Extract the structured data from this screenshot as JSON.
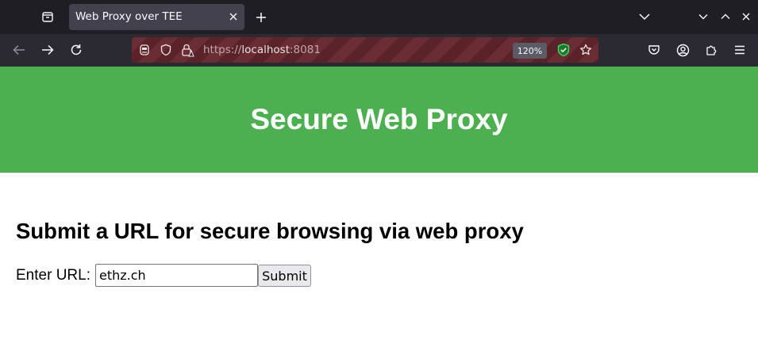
{
  "browser": {
    "tab": {
      "title": "Web Proxy over TEE"
    },
    "address_bar": {
      "url_scheme": "https://",
      "url_host": "localhost",
      "url_port": ":8081",
      "zoom": "120%"
    },
    "colors": {
      "tabstrip_bg": "#1f1e25",
      "navbar_bg": "#2b2a33",
      "urlbar_stripes": [
        "#6a2d33",
        "#5a2329"
      ],
      "shield_green": "#3fe1b0"
    },
    "icons": {
      "tab_list": "tab-list-icon",
      "close_tab": "close-icon",
      "new_tab": "plus-icon",
      "list_all_tabs": "chevron-down-icon",
      "minimize": "chevron-down-icon",
      "maximize": "chevron-up-icon",
      "close_window": "close-icon",
      "back": "back-arrow-icon",
      "forward": "forward-arrow-icon",
      "reload": "reload-icon",
      "remote_control": "robot-icon",
      "tracking_protection": "shield-icon",
      "insecure_lock": "lock-warning-icon",
      "extension_shield": "shield-check-icon",
      "bookmark": "star-icon",
      "pocket": "pocket-icon",
      "account": "account-icon",
      "extensions": "puzzle-icon",
      "menu": "hamburger-menu-icon"
    }
  },
  "page": {
    "header_title": "Secure Web Proxy",
    "header_color": "#4caf50",
    "form_title": "Submit a URL for secure browsing via web proxy",
    "url_label": "Enter URL:",
    "url_value": "ethz.ch",
    "submit_label": "Submit"
  }
}
